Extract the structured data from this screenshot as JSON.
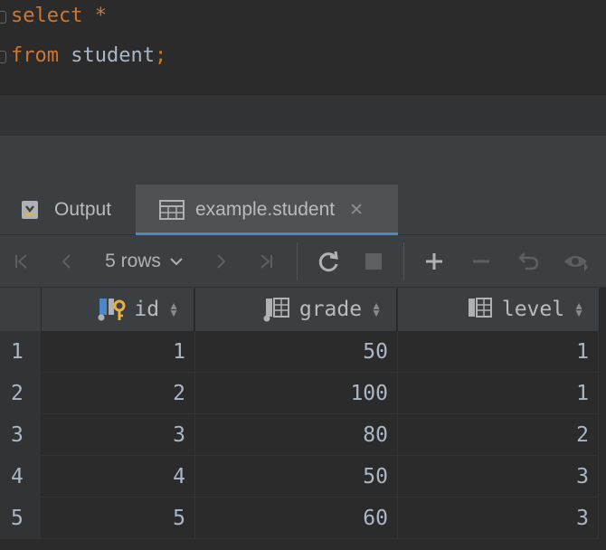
{
  "editor": {
    "line1": {
      "keyword": "select",
      "rest": " *"
    },
    "line2": {
      "keyword": "from",
      "table": " student",
      "semicolon": ";"
    }
  },
  "tabs": [
    {
      "label": "Output",
      "icon": "output-icon"
    },
    {
      "label": "example.student",
      "icon": "table-icon",
      "close": "✕"
    }
  ],
  "toolbar": {
    "rows_label": "5 rows",
    "buttons": [
      "first-page",
      "previous-page",
      "next-page",
      "last-page",
      "refresh",
      "stop",
      "add-row",
      "delete-row",
      "revert",
      "preview"
    ]
  },
  "grid": {
    "columns": [
      {
        "name": "id",
        "icon": "primary-key-column-icon"
      },
      {
        "name": "grade",
        "icon": "column-icon"
      },
      {
        "name": "level",
        "icon": "column-icon"
      }
    ],
    "rows": [
      {
        "n": "1",
        "id": "1",
        "grade": "50",
        "level": "1"
      },
      {
        "n": "2",
        "id": "2",
        "grade": "100",
        "level": "1"
      },
      {
        "n": "3",
        "id": "3",
        "grade": "80",
        "level": "2"
      },
      {
        "n": "4",
        "id": "4",
        "grade": "50",
        "level": "3"
      },
      {
        "n": "5",
        "id": "5",
        "grade": "60",
        "level": "3"
      }
    ]
  },
  "colors": {
    "keyword": "#cc7832",
    "identifier": "#a9b7c6",
    "accent": "#4a88c7",
    "key": "#e8b03d"
  }
}
